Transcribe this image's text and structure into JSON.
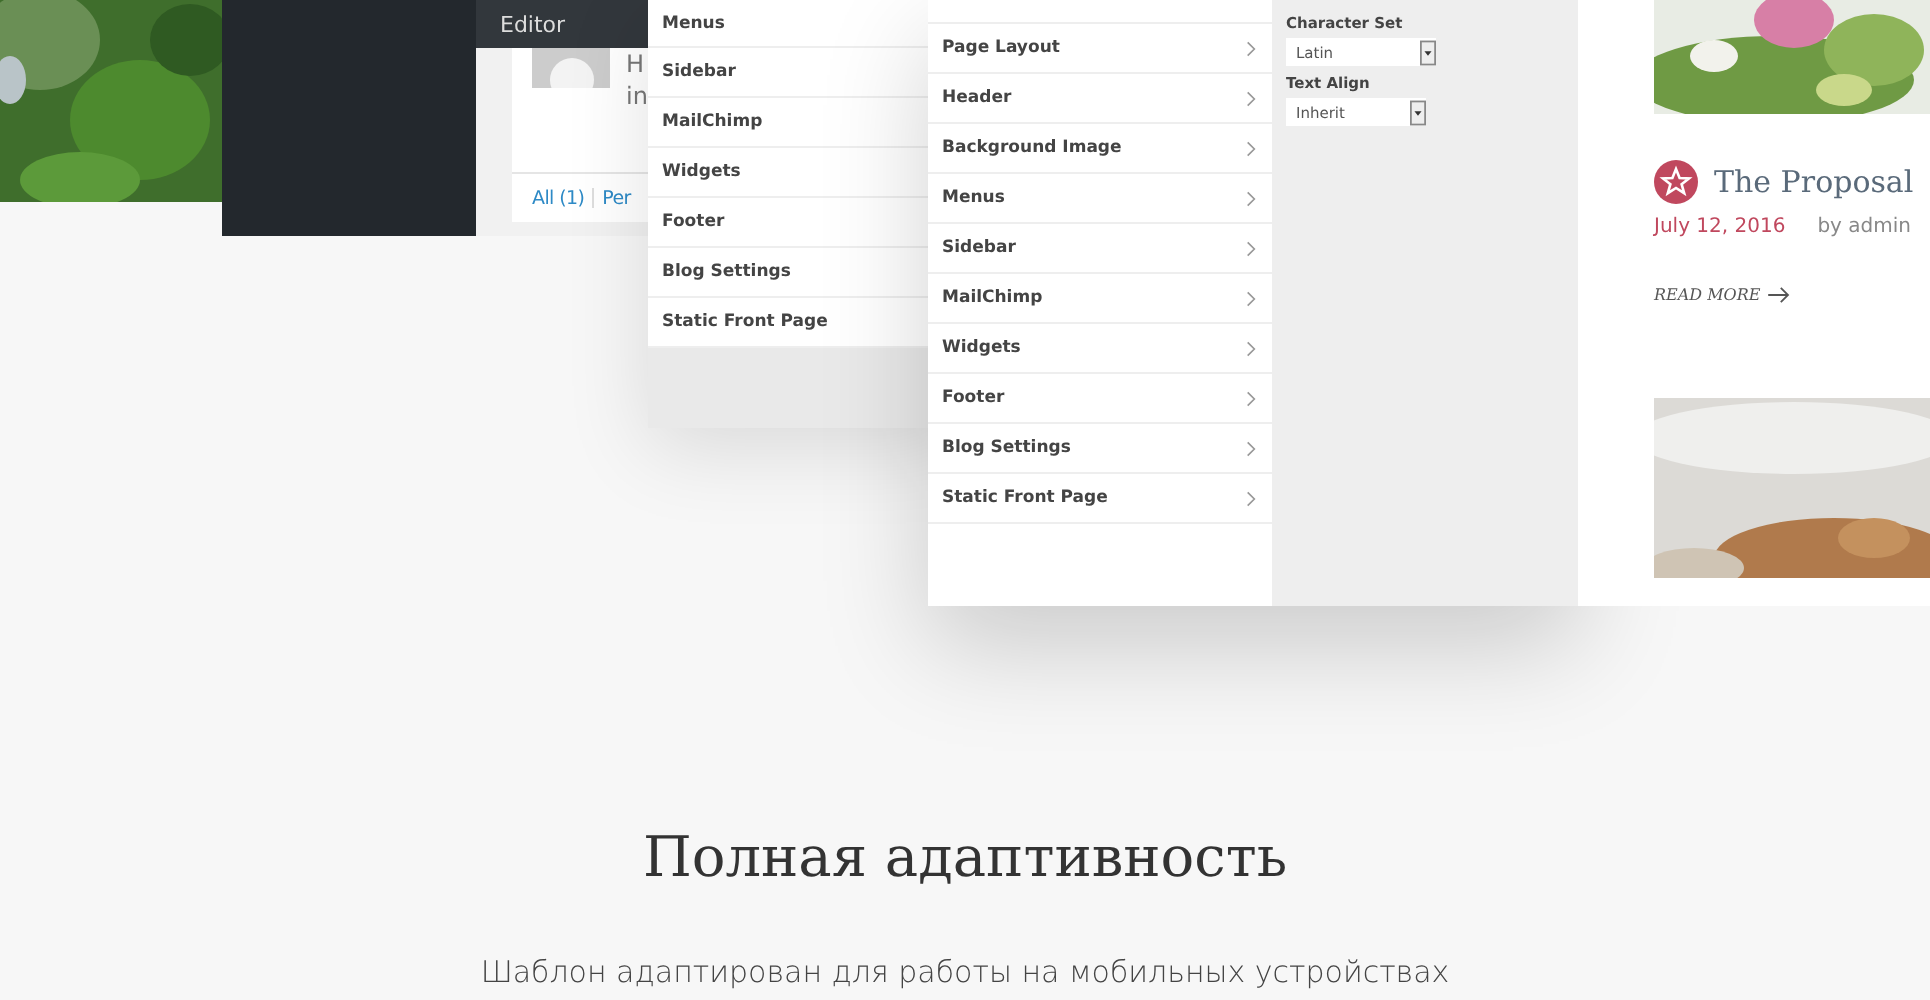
{
  "admin": {
    "menu_item": "Editor",
    "comment_lines": [
      "H",
      "in"
    ],
    "links": [
      "All (1)",
      "Per"
    ]
  },
  "customizer_back": {
    "sections": [
      "Menus",
      "Sidebar",
      "MailChimp",
      "Widgets",
      "Footer",
      "Blog Settings",
      "Static Front Page"
    ]
  },
  "customizer_front": {
    "sections": [
      "Page Layout",
      "Header",
      "Background Image",
      "Menus",
      "Sidebar",
      "MailChimp",
      "Widgets",
      "Footer",
      "Blog Settings",
      "Static Front Page"
    ],
    "fields": [
      {
        "label": "Character Set",
        "value": "Latin"
      },
      {
        "label": "Text Align",
        "value": "Inherit"
      }
    ]
  },
  "blog": {
    "title": "The Proposal",
    "date": "July 12, 2016",
    "author": "by admin",
    "read_more": "READ MORE"
  },
  "feature": {
    "title": "Полная адаптивность",
    "text": "Шаблон адаптирован для работы на мобильных устройствах"
  }
}
